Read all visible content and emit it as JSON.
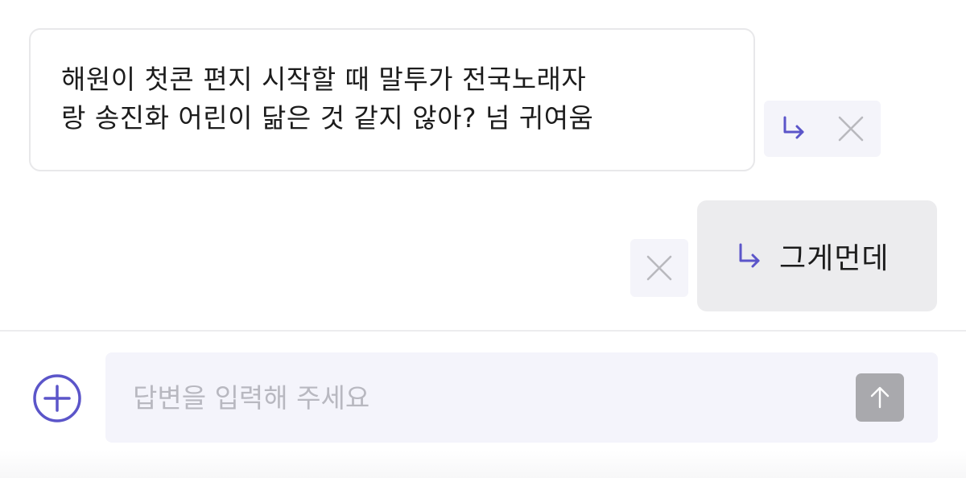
{
  "received_message": {
    "line1": "해원이 첫콘 편지 시작할 때 말투가 전국노래자",
    "line2": "랑 송진화 어린이 닮은 것 같지 않아? 넘 귀여움"
  },
  "sent_message": {
    "text": "그게먼데"
  },
  "composer": {
    "placeholder": "답변을 입력해 주세요",
    "value": ""
  },
  "icons": {
    "reply": "reply-arrow-icon",
    "close": "close-icon",
    "add": "plus-circle-icon",
    "send": "arrow-up-icon"
  },
  "colors": {
    "accent": "#5b55c9",
    "icon_gray": "#b9b9be",
    "send_button": "#a9a9ad",
    "sent_bubble": "#ececee",
    "input_bg": "#f4f4fb"
  }
}
